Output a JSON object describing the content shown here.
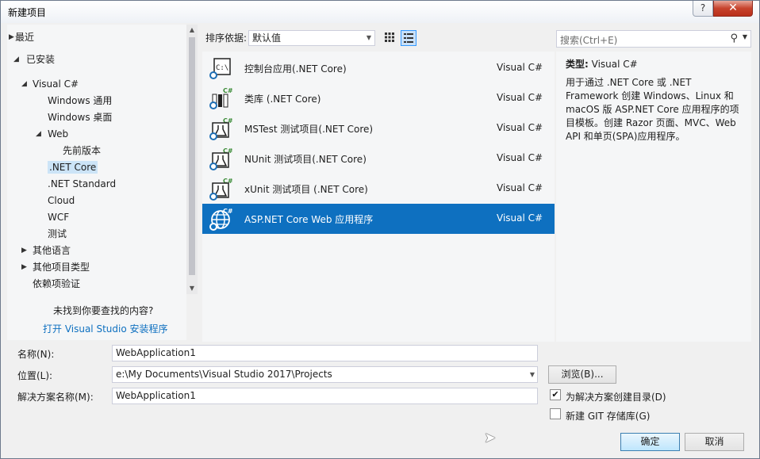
{
  "window": {
    "title": "新建项目",
    "help_label": "?",
    "close_label": "✕"
  },
  "tree": {
    "items": [
      {
        "label": "最近",
        "arrow": "▶"
      },
      {
        "label": "已安装",
        "arrow": "◢"
      },
      {
        "label": "Visual C#",
        "arrow": "◢"
      },
      {
        "label": "Windows 通用",
        "arrow": ""
      },
      {
        "label": "Windows 桌面",
        "arrow": ""
      },
      {
        "label": "Web",
        "arrow": "◢"
      },
      {
        "label": "先前版本",
        "arrow": ""
      },
      {
        "label": ".NET Core",
        "arrow": "",
        "selected": true
      },
      {
        "label": ".NET Standard",
        "arrow": ""
      },
      {
        "label": "Cloud",
        "arrow": ""
      },
      {
        "label": "WCF",
        "arrow": ""
      },
      {
        "label": "测试",
        "arrow": ""
      },
      {
        "label": "其他语言",
        "arrow": "▶"
      },
      {
        "label": "其他项目类型",
        "arrow": "▶"
      },
      {
        "label": "依赖项验证",
        "arrow": ""
      }
    ],
    "not_found": "未找到你要查找的内容?",
    "install_link": "打开 Visual Studio 安装程序"
  },
  "sort": {
    "label": "排序依据:",
    "value": "默认值",
    "dropdown_arrow": "▼",
    "grid_view_icon": "grid-view-icon",
    "list_view_icon": "list-view-icon"
  },
  "templates": [
    {
      "name": "控制台应用(.NET Core)",
      "lang": "Visual C#",
      "icon": "console-app-icon",
      "selected": false
    },
    {
      "name": "类库 (.NET Core)",
      "lang": "Visual C#",
      "icon": "class-library-icon",
      "selected": false
    },
    {
      "name": "MSTest 测试项目(.NET Core)",
      "lang": "Visual C#",
      "icon": "test-project-icon",
      "selected": false
    },
    {
      "name": "NUnit 测试项目(.NET Core)",
      "lang": "Visual C#",
      "icon": "test-project-icon",
      "selected": false
    },
    {
      "name": "xUnit 测试项目 (.NET Core)",
      "lang": "Visual C#",
      "icon": "test-project-icon",
      "selected": false
    },
    {
      "name": "ASP.NET Core Web 应用程序",
      "lang": "Visual C#",
      "icon": "web-app-globe-icon",
      "selected": true
    }
  ],
  "search": {
    "placeholder": "搜索(Ctrl+E)",
    "icon": "search-icon"
  },
  "info": {
    "type_label": "类型:",
    "type_value": "Visual C#",
    "description": "用于通过 .NET Core 或 .NET Framework 创建 Windows、Linux 和 macOS 版 ASP.NET Core 应用程序的项目模板。创建 Razor 页面、MVC、Web API 和单页(SPA)应用程序。"
  },
  "form": {
    "name_label": "名称(N):",
    "name_value": "WebApplication1",
    "location_label": "位置(L):",
    "location_value": "e:\\My Documents\\Visual Studio 2017\\Projects",
    "solution_label": "解决方案名称(M):",
    "solution_value": "WebApplication1",
    "browse_label": "浏览(B)...",
    "create_dir_label": "为解决方案创建目录(D)",
    "create_dir_checked": true,
    "git_label": "新建 GIT 存储库(G)",
    "git_checked": false,
    "ok_label": "确定",
    "cancel_label": "取消"
  },
  "colors": {
    "accent": "#0e70c0",
    "selected_tree": "#cce4f7",
    "link": "#0e70c0"
  }
}
